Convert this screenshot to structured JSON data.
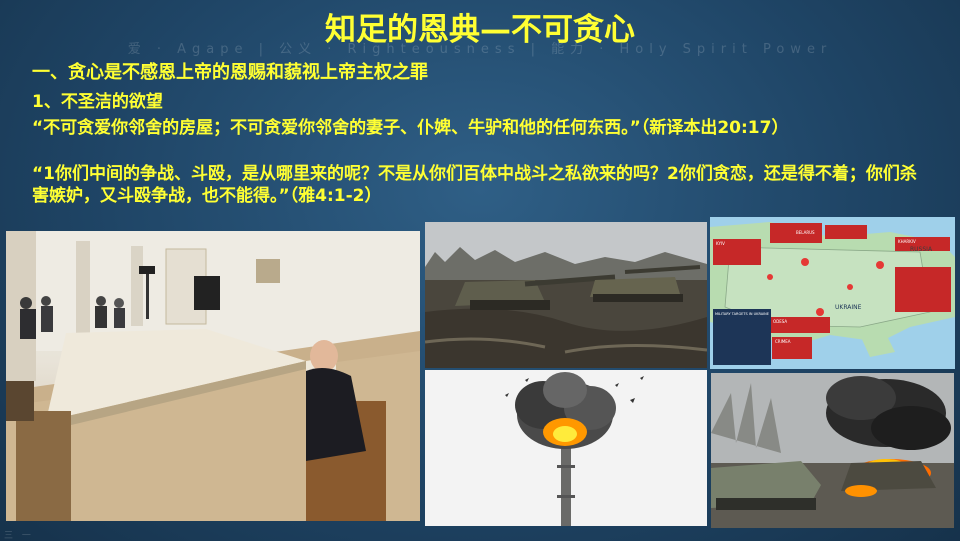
{
  "slide": {
    "title": "知足的恩典—不可贪心",
    "watermark": "爱 · Agape  |  公义 · Righteousness  |  能力 · Holy Spirit Power",
    "footer_mark": "三 一",
    "heading1": "一、贪心是不感恩上帝的恩赐和藐视上帝主权之罪",
    "heading2": "1、不圣洁的欲望",
    "verse1": "“不可贪爱你邻舍的房屋；不可贪爱你邻舍的妻子、仆婢、牛驴和他的任何东西。”（新译本出20:17）",
    "verse2": "“1你们中间的争战、斗殴，是从哪里来的呢？不是从你们百体中战斗之私欲来的吗？2你们贪恋，还是得不着；你们杀害嫉妒，又斗殴争战，也不能得。”（雅4:1-2）"
  },
  "map_labels": {
    "belarus": "BELARUS",
    "russia": "RUSSIA",
    "ukraine": "UKRAINE",
    "kyiv": "KYIV",
    "kharkiv": "KHARKIV",
    "odesa": "ODESA",
    "crimea": "CRIMEA",
    "legend_title": "MILITARY TARGETS IN UKRAINE"
  },
  "colors": {
    "background": "#1f4566",
    "title_text": "#ffff33",
    "body_text": "#ffff33"
  }
}
